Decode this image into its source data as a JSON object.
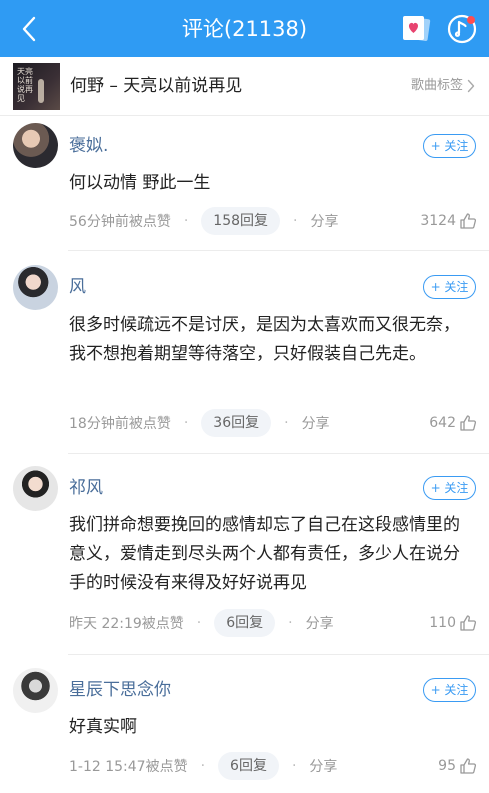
{
  "header": {
    "title": "评论(21138)",
    "back_icon": "chevron-left-icon",
    "background": "#2f9bf3"
  },
  "song": {
    "title": "何野 – 天亮以前说再见",
    "tag_label": "歌曲标签",
    "cover_text": "天亮以前说再见"
  },
  "comments": [
    {
      "username": "褒姒.",
      "follow_label": "+ 关注",
      "content": "何以动情 野此一生",
      "time": "56分钟前被点赞",
      "replies": "158回复",
      "share": "分享",
      "likes": "3124"
    },
    {
      "username": "风",
      "follow_label": "+ 关注",
      "content": "很多时候疏远不是讨厌，是因为太喜欢而又很无奈，我不想抱着期望等待落空，只好假装自己先走。",
      "time": "18分钟前被点赞",
      "replies": "36回复",
      "share": "分享",
      "likes": "642"
    },
    {
      "username": "祁风",
      "follow_label": "+ 关注",
      "content": "我们拼命想要挽回的感情却忘了自己在这段感情里的意义，爱情走到尽头两个人都有责任，多少人在说分手的时候没有来得及好好说再见",
      "time": "昨天 22:19被点赞",
      "replies": "6回复",
      "share": "分享",
      "likes": "110"
    },
    {
      "username": "星辰下思念你",
      "follow_label": "+ 关注",
      "content": "好真实啊",
      "time": "1-12 15:47被点赞",
      "replies": "6回复",
      "share": "分享",
      "likes": "95"
    }
  ]
}
